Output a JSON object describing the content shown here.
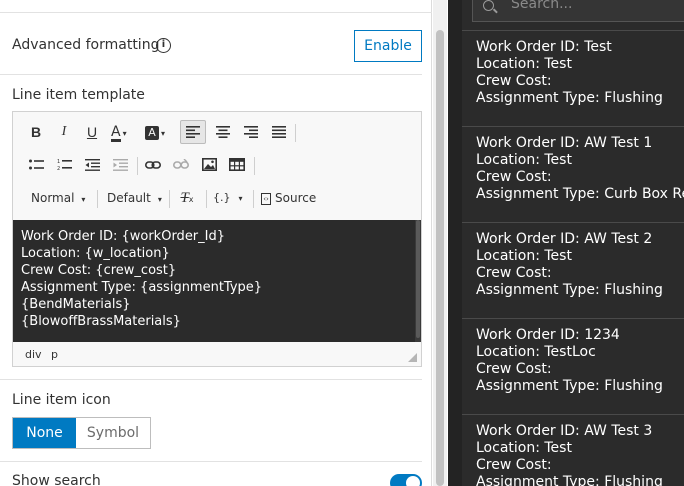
{
  "settings": {
    "advanced_formatting_label": "Advanced formatting",
    "info_glyph": "i",
    "enable_button": "Enable",
    "line_item_template_label": "Line item template",
    "editor": {
      "format_select": "Normal",
      "font_select": "Default",
      "placeholder_select": "{.}",
      "source_button": "Source",
      "content_lines": [
        "Work Order ID: {workOrder_Id}",
        "Location: {w_location}",
        "Crew Cost: {crew_cost}",
        "Assignment Type: {assignmentType}",
        "{BendMaterials}",
        "{BlowoffBrassMaterials}"
      ],
      "status_path": [
        "div",
        "p"
      ]
    },
    "line_item_icon_label": "Line item icon",
    "icon_options": [
      "None",
      "Symbol"
    ],
    "icon_selected": "None",
    "show_search_label": "Show search",
    "show_search_enabled": true
  },
  "preview": {
    "search_placeholder": "Search...",
    "items": [
      {
        "lines": [
          "Work Order ID: Test",
          "Location: Test",
          "Crew Cost:",
          "Assignment Type: Flushing"
        ]
      },
      {
        "lines": [
          "Work Order ID: AW Test 1",
          "Location: Test",
          "Crew Cost:",
          "Assignment Type: Curb Box Repl"
        ]
      },
      {
        "lines": [
          "Work Order ID: AW Test 2",
          "Location: Test",
          "Crew Cost:",
          "Assignment Type: Flushing"
        ]
      },
      {
        "lines": [
          "Work Order ID: 1234",
          "Location: TestLoc",
          "Crew Cost:",
          "Assignment Type: Flushing"
        ]
      },
      {
        "lines": [
          "Work Order ID: AW Test 3",
          "Location: Test",
          "Crew Cost:",
          "Assignment Type: Flushing"
        ]
      }
    ]
  },
  "colors": {
    "accent": "#007ac2",
    "editor_bg": "#2b2b2b",
    "preview_bg": "#2b2b2b"
  }
}
